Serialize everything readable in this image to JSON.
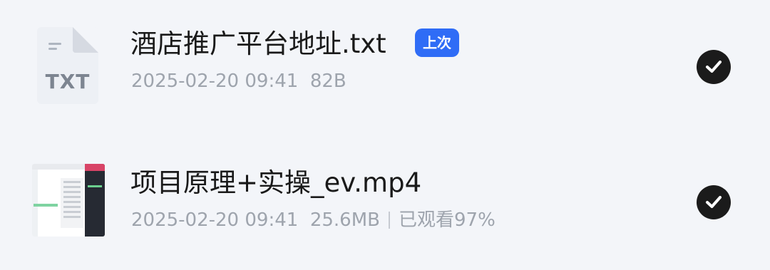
{
  "files": [
    {
      "name": "酒店推广平台地址.txt",
      "badge": "上次",
      "date": "2025-02-20 09:41",
      "size": "82B",
      "icon": "txt-file-icon",
      "icon_label": "TXT",
      "selected": true
    },
    {
      "name": "项目原理+实操_ev.mp4",
      "date": "2025-02-20 09:41",
      "size": "25.6MB",
      "watched": "已观看97%",
      "icon": "video-thumbnail",
      "selected": true
    }
  ],
  "colors": {
    "background": "#f3f5f9",
    "badge": "#2f6cf6",
    "check": "#1b1b1b",
    "meta_text": "#9ea4ad"
  }
}
